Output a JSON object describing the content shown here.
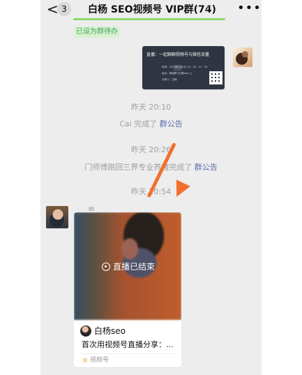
{
  "header": {
    "back_symbol": "<",
    "unread_count": "3",
    "title": "白杨 SEO视频号 VIP群(74)",
    "mute_icon": "muted-bell-icon",
    "more_icon": "more-icon"
  },
  "pinned": {
    "todo_label": "已设为群待办"
  },
  "poster": {
    "title": "直播：一起聊聊视频号与微信流量",
    "line1": "时间：2024年1月3日  20：00 - 21：30",
    "line2": "地点：微信群 (白杨seo) 上",
    "line3": "分享人：白杨"
  },
  "timeline": {
    "time_1": "昨天 20:10",
    "event_1_prefix": "Cai 完成了",
    "event_1_link": "群公告",
    "time_2": "昨天 20:26",
    "event_2_prefix": "门师傅跳回三界专业养猪完成了",
    "event_2_link": "群公告",
    "time_3": "昨天 20:54"
  },
  "live_card": {
    "status_text": "直播已结束",
    "profile_name": "白杨seo",
    "description": "首次用视频号直播分享：...",
    "source_label": "视频号",
    "source_icon": "channels-icon"
  },
  "colors": {
    "chat_background": "#ededed",
    "accent_orange": "#f36f2d",
    "link_blue": "#5b6fa8",
    "todo_green": "#41a85b"
  }
}
